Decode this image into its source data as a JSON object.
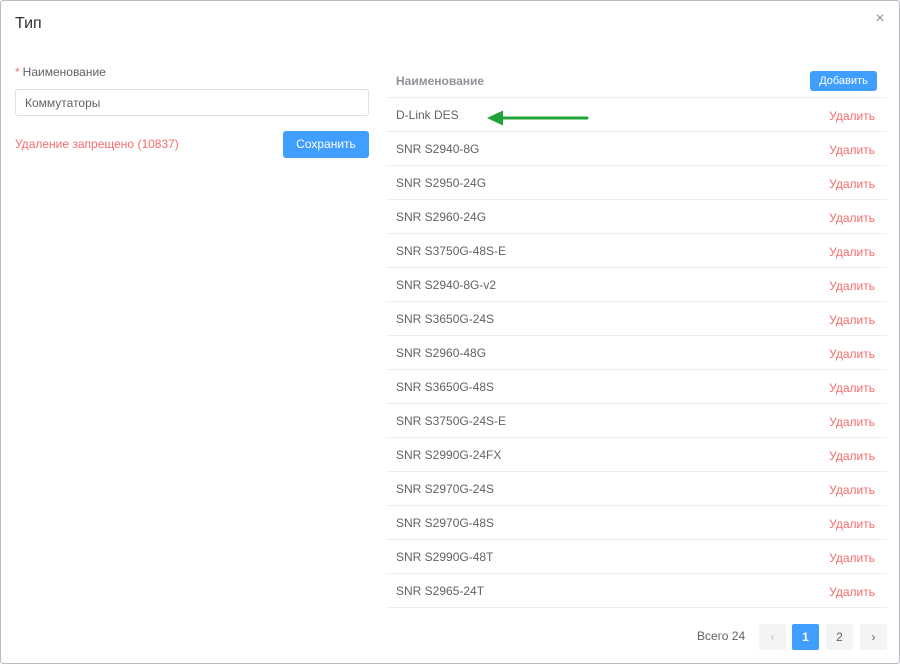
{
  "dialog": {
    "title": "Тип",
    "close_icon": "×"
  },
  "form": {
    "required_mark": "*",
    "name_label": "Наименование",
    "name_value": "Коммутаторы",
    "delete_forbidden": "Удаление запрещено (10837)",
    "save_label": "Сохранить"
  },
  "table": {
    "header_name": "Наименование",
    "add_label": "Добавить",
    "rows": [
      {
        "name": "D-Link DES",
        "action": "Удалить"
      },
      {
        "name": "SNR S2940-8G",
        "action": "Удалить"
      },
      {
        "name": "SNR S2950-24G",
        "action": "Удалить"
      },
      {
        "name": "SNR S2960-24G",
        "action": "Удалить"
      },
      {
        "name": "SNR S3750G-48S-E",
        "action": "Удалить"
      },
      {
        "name": "SNR S2940-8G-v2",
        "action": "Удалить"
      },
      {
        "name": "SNR S3650G-24S",
        "action": "Удалить"
      },
      {
        "name": "SNR S2960-48G",
        "action": "Удалить"
      },
      {
        "name": "SNR S3650G-48S",
        "action": "Удалить"
      },
      {
        "name": "SNR S3750G-24S-E",
        "action": "Удалить"
      },
      {
        "name": "SNR S2990G-24FX",
        "action": "Удалить"
      },
      {
        "name": "SNR S2970G-24S",
        "action": "Удалить"
      },
      {
        "name": "SNR S2970G-48S",
        "action": "Удалить"
      },
      {
        "name": "SNR S2990G-48T",
        "action": "Удалить"
      },
      {
        "name": "SNR S2965-24T",
        "action": "Удалить"
      }
    ]
  },
  "pagination": {
    "total": "Всего 24",
    "prev_icon": "‹",
    "pages": [
      "1",
      "2"
    ],
    "current_page": "1",
    "next_icon": "›"
  },
  "annotation": {
    "arrow_color": "#22a33a"
  },
  "colors": {
    "primary": "#409eff",
    "danger": "#f56c6c"
  }
}
